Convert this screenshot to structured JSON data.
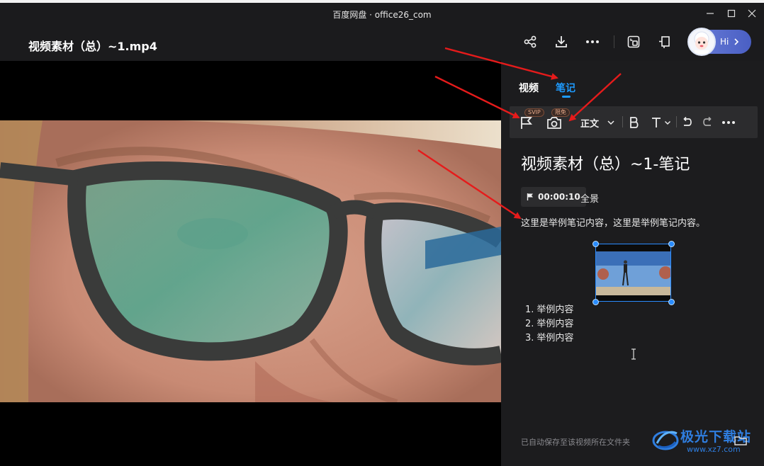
{
  "window": {
    "title": "百度网盘 · office26_com"
  },
  "header": {
    "filename": "视频素材（总）~1.mp4",
    "hi_label": "Hi",
    "icons": [
      "share-icon",
      "download-icon",
      "more-icon",
      "screen-icon",
      "pin-icon"
    ]
  },
  "panel": {
    "tabs": [
      {
        "label": "视频"
      },
      {
        "label": "笔记"
      }
    ],
    "toolbar": {
      "badge_svip": "SVIP",
      "badge_free": "限免",
      "style_label": "正文"
    },
    "note": {
      "title": "视频素材（总）~1-笔记",
      "timestamp": "00:00:10",
      "timestamp_label": "全景",
      "paragraph": "这里是举例笔记内容，这里是举例笔记内容。",
      "list": [
        {
          "num": "1.",
          "text": "举例内容"
        },
        {
          "num": "2.",
          "text": "举例内容"
        },
        {
          "num": "3.",
          "text": "举例内容"
        }
      ]
    },
    "footer": "已自动保存至该视频所在文件夹"
  },
  "watermark": {
    "line1": "极光下载站",
    "line2": "www.xz7.com"
  },
  "colors": {
    "accent": "#1e9bff",
    "background": "#1b1b1d",
    "arrow": "#e51b1b"
  }
}
